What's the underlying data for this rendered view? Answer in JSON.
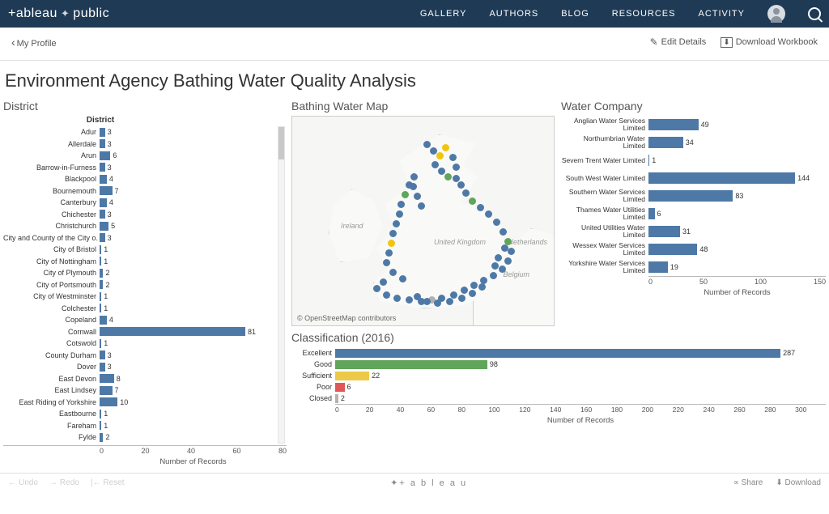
{
  "header": {
    "brand_a": "+ableau",
    "brand_b": "public",
    "nav": [
      "GALLERY",
      "AUTHORS",
      "BLOG",
      "RESOURCES",
      "ACTIVITY"
    ]
  },
  "subheader": {
    "back": "My Profile",
    "edit": "Edit Details",
    "download": "Download Workbook"
  },
  "title": "Environment Agency Bathing Water Quality Analysis",
  "panels": {
    "district": "District",
    "district_header": "District",
    "map": "Bathing Water Map",
    "watercompany": "Water Company",
    "classification": "Classification (2016)"
  },
  "chart_data": {
    "district": {
      "type": "bar",
      "orientation": "horizontal",
      "xlabel": "Number of Records",
      "xlim": [
        0,
        90
      ],
      "xticks": [
        0,
        20,
        40,
        60,
        80
      ],
      "series": [
        {
          "name": "Adur",
          "value": 3
        },
        {
          "name": "Allerdale",
          "value": 3
        },
        {
          "name": "Arun",
          "value": 6
        },
        {
          "name": "Barrow-in-Furness",
          "value": 3
        },
        {
          "name": "Blackpool",
          "value": 4
        },
        {
          "name": "Bournemouth",
          "value": 7
        },
        {
          "name": "Canterbury",
          "value": 4
        },
        {
          "name": "Chichester",
          "value": 3
        },
        {
          "name": "Christchurch",
          "value": 5
        },
        {
          "name": "City and County of the City o.",
          "value": 3
        },
        {
          "name": "City of Bristol",
          "value": 1
        },
        {
          "name": "City of Nottingham",
          "value": 1
        },
        {
          "name": "City of Plymouth",
          "value": 2
        },
        {
          "name": "City of Portsmouth",
          "value": 2
        },
        {
          "name": "City of Westminster",
          "value": 1
        },
        {
          "name": "Colchester",
          "value": 1
        },
        {
          "name": "Copeland",
          "value": 4
        },
        {
          "name": "Cornwall",
          "value": 81
        },
        {
          "name": "Cotswold",
          "value": 1
        },
        {
          "name": "County Durham",
          "value": 3
        },
        {
          "name": "Dover",
          "value": 3
        },
        {
          "name": "East Devon",
          "value": 8
        },
        {
          "name": "East Lindsey",
          "value": 7
        },
        {
          "name": "East Riding of Yorkshire",
          "value": 10
        },
        {
          "name": "Eastbourne",
          "value": 1
        },
        {
          "name": "Fareham",
          "value": 1
        },
        {
          "name": "Fylde",
          "value": 2
        }
      ]
    },
    "water_company": {
      "type": "bar",
      "orientation": "horizontal",
      "xlabel": "Number of Records",
      "xlim": [
        0,
        155
      ],
      "xticks": [
        0,
        50,
        100,
        150
      ],
      "series": [
        {
          "name": "Anglian Water Services Limited",
          "value": 49
        },
        {
          "name": "Northumbrian Water Limited",
          "value": 34
        },
        {
          "name": "Severn Trent Water Limited",
          "value": 1
        },
        {
          "name": "South West Water Limited",
          "value": 144
        },
        {
          "name": "Southern Water Services Limited",
          "value": 83
        },
        {
          "name": "Thames Water Utilities Limited",
          "value": 6
        },
        {
          "name": "United Utilities Water Limited",
          "value": 31
        },
        {
          "name": "Wessex Water Services Limited",
          "value": 48
        },
        {
          "name": "Yorkshire Water Services Limited",
          "value": 19
        }
      ]
    },
    "classification": {
      "type": "bar",
      "orientation": "horizontal",
      "xlabel": "Number of Records",
      "xlim": [
        0,
        300
      ],
      "xticks": [
        0,
        20,
        40,
        60,
        80,
        100,
        120,
        140,
        160,
        180,
        200,
        220,
        240,
        260,
        280,
        300
      ],
      "series": [
        {
          "name": "Excellent",
          "value": 287,
          "color": "#4e79a7"
        },
        {
          "name": "Good",
          "value": 98,
          "color": "#5fa55a"
        },
        {
          "name": "Sufficient",
          "value": 22,
          "color": "#edc948"
        },
        {
          "name": "Poor",
          "value": 6,
          "color": "#e15759"
        },
        {
          "name": "Closed",
          "value": 2,
          "color": "#bab0ac"
        }
      ]
    }
  },
  "map": {
    "attribution": "© OpenStreetMap contributors",
    "labels": {
      "ireland": "Ireland",
      "uk": "United Kingdom",
      "nl": "Netherlands",
      "be": "Belgium"
    }
  },
  "footer": {
    "undo": "Undo",
    "redo": "Redo",
    "reset": "Reset",
    "share": "Share",
    "download": "Download",
    "logo": "+ a b l e a u"
  }
}
